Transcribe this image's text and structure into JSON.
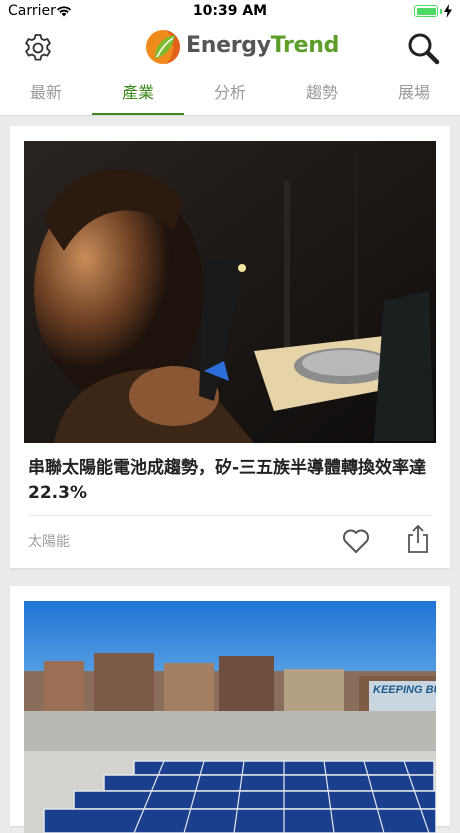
{
  "status_bar": {
    "carrier": "Carrier",
    "time": "10:39 AM"
  },
  "header": {
    "logo_text_part1": "Energy",
    "logo_text_part2": "Trend",
    "accent_color": "#5c9e28"
  },
  "tabs": [
    {
      "label": "最新",
      "active": false
    },
    {
      "label": "產業",
      "active": true
    },
    {
      "label": "分析",
      "active": false
    },
    {
      "label": "趨勢",
      "active": false
    },
    {
      "label": "展場",
      "active": false
    }
  ],
  "articles": [
    {
      "title": "串聯太陽能電池成趨勢，矽-三五族半導體轉換效率達 22.3%",
      "category": "太陽能",
      "image": "photo-scientist-examining-wafer"
    },
    {
      "image": "photo-rooftop-solar-panels",
      "billboard_text": "KEEPING BUSI"
    }
  ]
}
